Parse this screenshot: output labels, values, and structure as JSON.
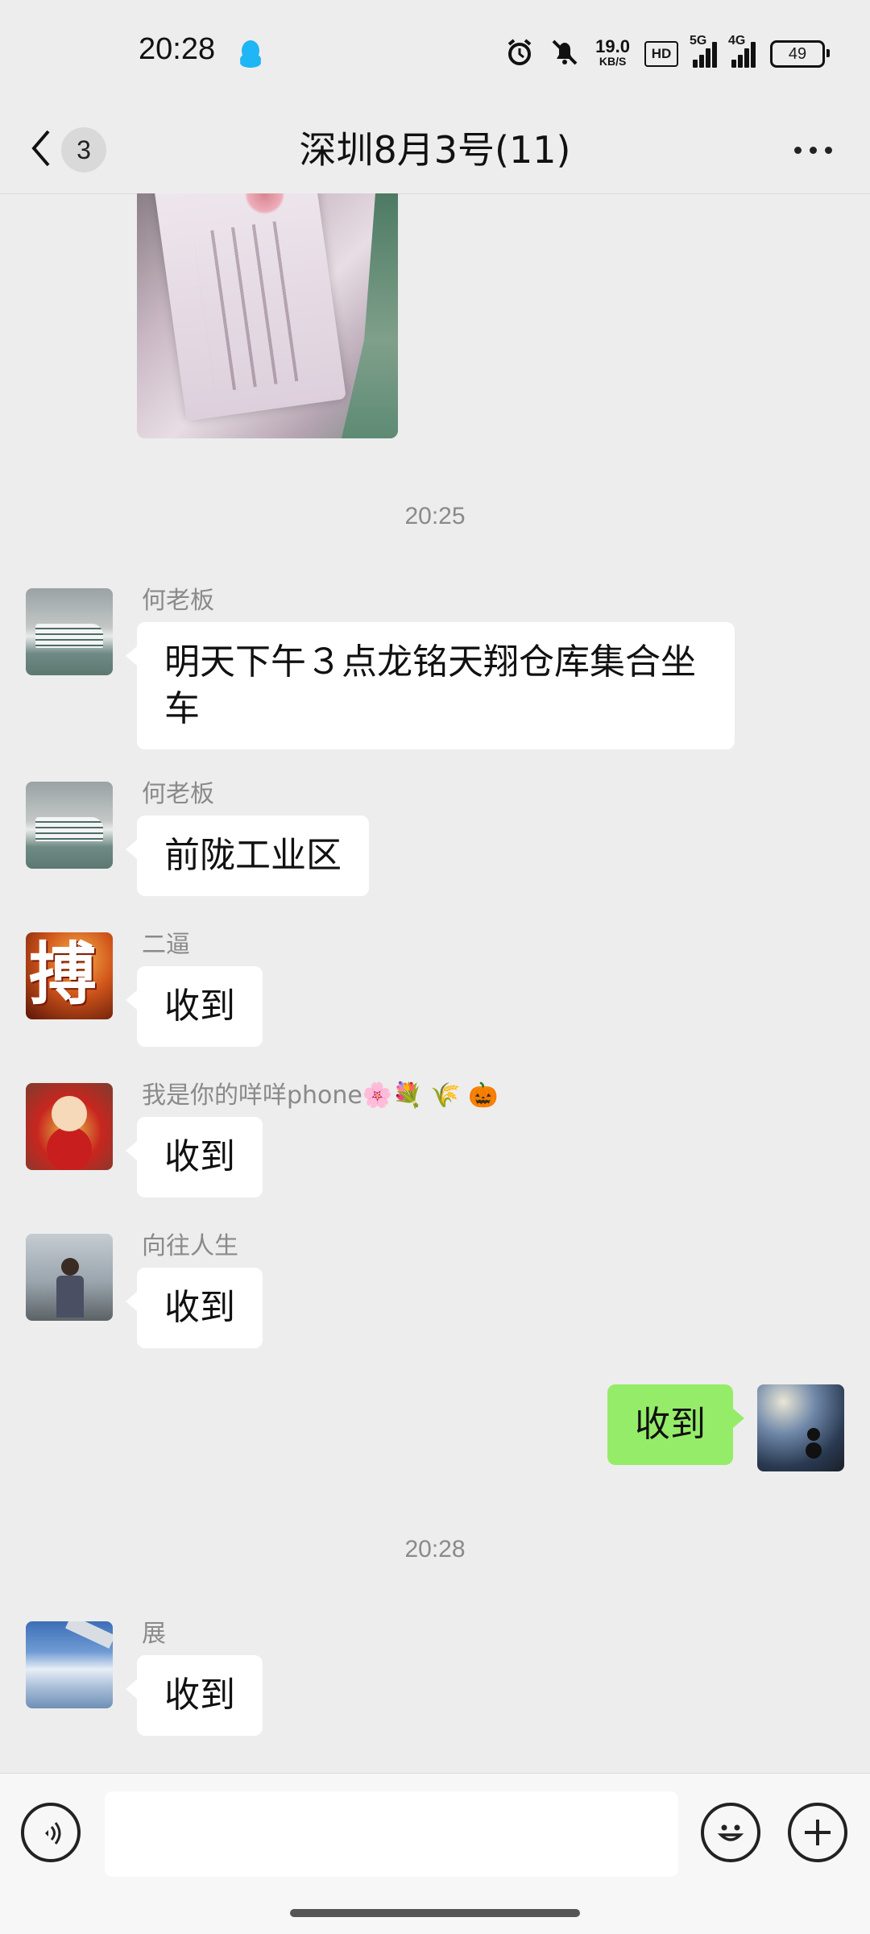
{
  "status_bar": {
    "time": "20:28",
    "net_speed_value": "19.0",
    "net_speed_unit": "KB/S",
    "hd_label": "HD",
    "sig1_label": "5G",
    "sig2_label": "4G",
    "battery": "49",
    "icons": [
      "qq-icon",
      "alarm-icon",
      "mute-icon",
      "hd-icon",
      "signal-5g-icon",
      "signal-4g-icon",
      "battery-icon"
    ]
  },
  "header": {
    "unread_count": "3",
    "title": "深圳8月3号(11)"
  },
  "messages": {
    "time1": "20:25",
    "m1_sender": "何老板",
    "m1_text": "明天下午３点龙铭天翔仓库集合坐车",
    "m2_sender": "何老板",
    "m2_text": "前陇工业区",
    "m3_sender": "二逼",
    "m3_text": "收到",
    "m4_sender": "我是你的咩咩phone🌸💐 🌾 🎃",
    "m4_text": "收到",
    "m5_sender": "向往人生",
    "m5_text": "收到",
    "m6_text": "收到",
    "time2": "20:28",
    "m7_sender": "展",
    "m7_text": "收到"
  },
  "input": {
    "value": "",
    "placeholder": ""
  },
  "colors": {
    "background": "#ededed",
    "own_bubble": "#95ec69",
    "other_bubble": "#ffffff"
  }
}
